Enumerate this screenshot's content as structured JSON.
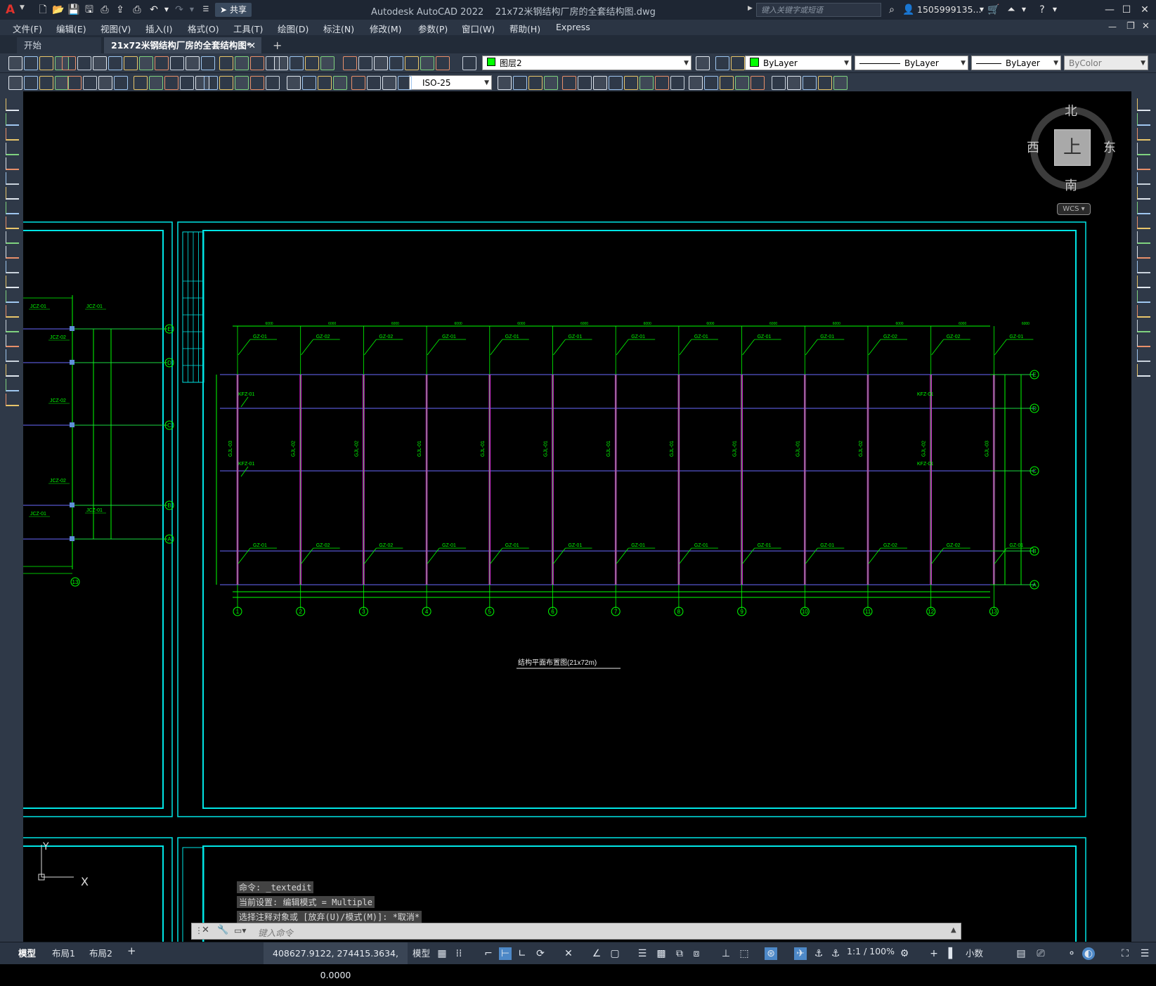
{
  "app": {
    "title": "Autodesk AutoCAD 2022",
    "document_title": "21x72米钢结构厂房的全套结构图.dwg",
    "share_label": "共享",
    "search_placeholder": "键入关键字或短语",
    "user": "1505999135...",
    "logo_letter": "A"
  },
  "menus": [
    "文件(F)",
    "编辑(E)",
    "视图(V)",
    "插入(I)",
    "格式(O)",
    "工具(T)",
    "绘图(D)",
    "标注(N)",
    "修改(M)",
    "参数(P)",
    "窗口(W)",
    "帮助(H)",
    "Express"
  ],
  "tabs": [
    {
      "label": "开始",
      "active": false
    },
    {
      "label": "21x72米钢结构厂房的全套结构图*",
      "active": true
    }
  ],
  "toolbar": {
    "layer": "图层2",
    "color": "ByLayer",
    "linetype": "ByLayer",
    "lineweight": "ByLayer",
    "plotstyle": "ByColor",
    "dimstyle": "ISO-25"
  },
  "viewcube": {
    "north": "北",
    "south": "南",
    "east": "东",
    "west": "西",
    "face": "上",
    "wcs": "WCS"
  },
  "drawing": {
    "title": "结构平面布置图(21x72m)",
    "col_labels": [
      "GZ-01",
      "GZ-02",
      "GZ-02",
      "GZ-01",
      "GZ-01",
      "GZ-01",
      "GZ-01",
      "GZ-01",
      "GZ-01",
      "GZ-01",
      "GZ-02",
      "GZ-02",
      "GZ-01"
    ],
    "bot_labels": [
      "GZ-01",
      "GZ-02",
      "GZ-02",
      "GZ-01",
      "GZ-01",
      "GZ-01",
      "GZ-01",
      "GZ-01",
      "GZ-01",
      "GZ-01",
      "GZ-02",
      "GZ-02",
      "GZ-01"
    ],
    "axis_numbers": [
      "1",
      "2",
      "3",
      "4",
      "5",
      "6",
      "7",
      "8",
      "9",
      "10",
      "11",
      "12",
      "13"
    ],
    "row_letters": [
      "E",
      "D",
      "C",
      "B",
      "A"
    ],
    "left_labels": [
      "KFZ-01",
      "KFZ-01"
    ],
    "right_labels": [
      "KFZ-01",
      "KFZ-01"
    ],
    "beam_labels": [
      "GJL-03",
      "GJL-02",
      "GJL-02",
      "GJL-01",
      "GJL-01",
      "GJL-01",
      "GJL-01",
      "GJL-01",
      "GJL-01",
      "GJL-01",
      "GJL-02",
      "GJL-02",
      "GJL-03"
    ],
    "side_labels": [
      "JCZ-01",
      "JCZ-01",
      "JCZ-02",
      "JCZ-02",
      "JCZ-02",
      "JCZ-01",
      "JCZ-01"
    ],
    "side_axis": "13"
  },
  "command": {
    "history": [
      "命令: _textedit",
      "当前设置: 编辑模式 = Multiple",
      "选择注释对象或 [放弃(U)/模式(M)]: *取消*"
    ],
    "prompt": "键入命令"
  },
  "status": {
    "layout_tabs": [
      "模型",
      "布局1",
      "布局2"
    ],
    "coords": "408627.9122, 274415.3634, 0.0000",
    "space": "模型",
    "scale": "1:1 / 100%",
    "units": "小数"
  },
  "ucs": {
    "x": "X",
    "y": "Y"
  }
}
